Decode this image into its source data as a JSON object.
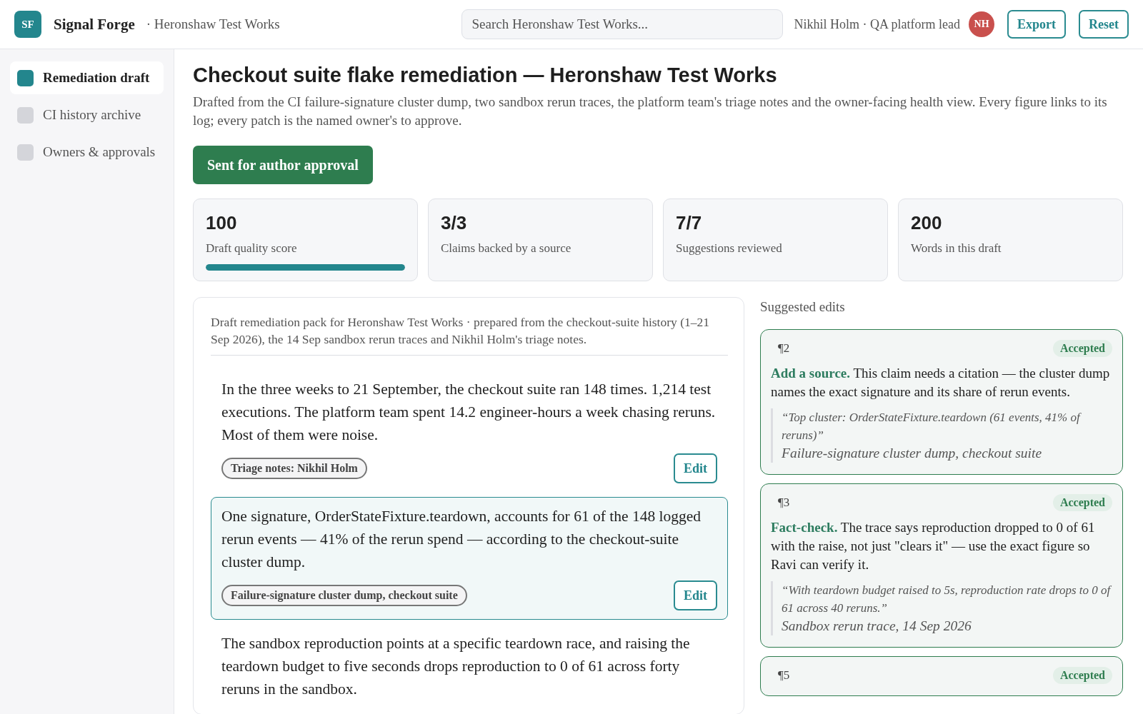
{
  "app": {
    "logo": "SF",
    "name": "Signal Forge",
    "workspace": "· Heronshaw Test Works"
  },
  "search": {
    "placeholder": "Search Heronshaw Test Works..."
  },
  "user": {
    "label": "Nikhil Holm · QA platform lead",
    "initials": "NH"
  },
  "header_buttons": [
    "Export",
    "Reset"
  ],
  "sidebar": {
    "items": [
      {
        "label": "Remediation draft",
        "selected": true
      },
      {
        "label": "CI history archive",
        "selected": false
      },
      {
        "label": "Owners & approvals",
        "selected": false
      }
    ]
  },
  "page": {
    "title": "Checkout suite flake remediation — Heronshaw Test Works",
    "subtitle": "Drafted from the CI failure-signature cluster dump, two sandbox rerun traces, the platform team's triage notes and the owner-facing health view. Every figure links to its log; every patch is the named owner's to approve.",
    "status_button": "Sent for author approval"
  },
  "stats": [
    {
      "value": "100",
      "label": "Draft quality score",
      "level": 1.0
    },
    {
      "value": "3/3",
      "label": "Claims backed by a source"
    },
    {
      "value": "7/7",
      "label": "Suggestions reviewed"
    },
    {
      "value": "200",
      "label": "Words in this draft"
    }
  ],
  "document": {
    "intro": "Draft remediation pack for Heronshaw Test Works · prepared from the checkout-suite history (1–21 Sep 2026), the 14 Sep sandbox rerun traces and Nikhil Holm's triage notes.",
    "paragraphs": [
      {
        "text": "In the three weeks to 21 September, the checkout suite ran 148 times. 1,214 test executions. The platform team spent 14.2 engineer-hours a week chasing reruns. Most of them were noise.",
        "source": "Triage notes: Nikhil Holm",
        "edit": "Edit",
        "selected": false
      },
      {
        "text": "One signature, OrderStateFixture.teardown, accounts for 61 of the 148 logged rerun events — 41% of the rerun spend — according to the checkout-suite cluster dump.",
        "source": "Failure-signature cluster dump, checkout suite",
        "edit": "Edit",
        "selected": true
      },
      {
        "text": "The sandbox reproduction points at a specific teardown race, and raising the teardown budget to five seconds drops reproduction to 0 of 61 across forty reruns in the sandbox.",
        "selected": false
      }
    ]
  },
  "suggestions": {
    "title": "Suggested edits",
    "items": [
      {
        "paragraph": "¶2",
        "status": "Accepted",
        "text": "**Add a source.** This claim needs a citation — the cluster dump names the exact signature and its share of rerun events.",
        "quote": "“Top cluster: OrderStateFixture.teardown (61 events, 41% of reruns)”",
        "citation": "Failure-signature cluster dump, checkout suite"
      },
      {
        "paragraph": "¶3",
        "status": "Accepted",
        "text": "**Fact-check.** The trace says reproduction dropped to 0 of 61 with the raise, not just \"clears it\" — use the exact figure so Ravi can verify it.",
        "quote": "“With teardown budget raised to 5s, reproduction rate drops to 0 of 61 across 40 reruns.”",
        "citation": "Sandbox rerun trace, 14 Sep 2026"
      },
      {
        "paragraph": "¶5",
        "status": "Accepted"
      }
    ]
  }
}
